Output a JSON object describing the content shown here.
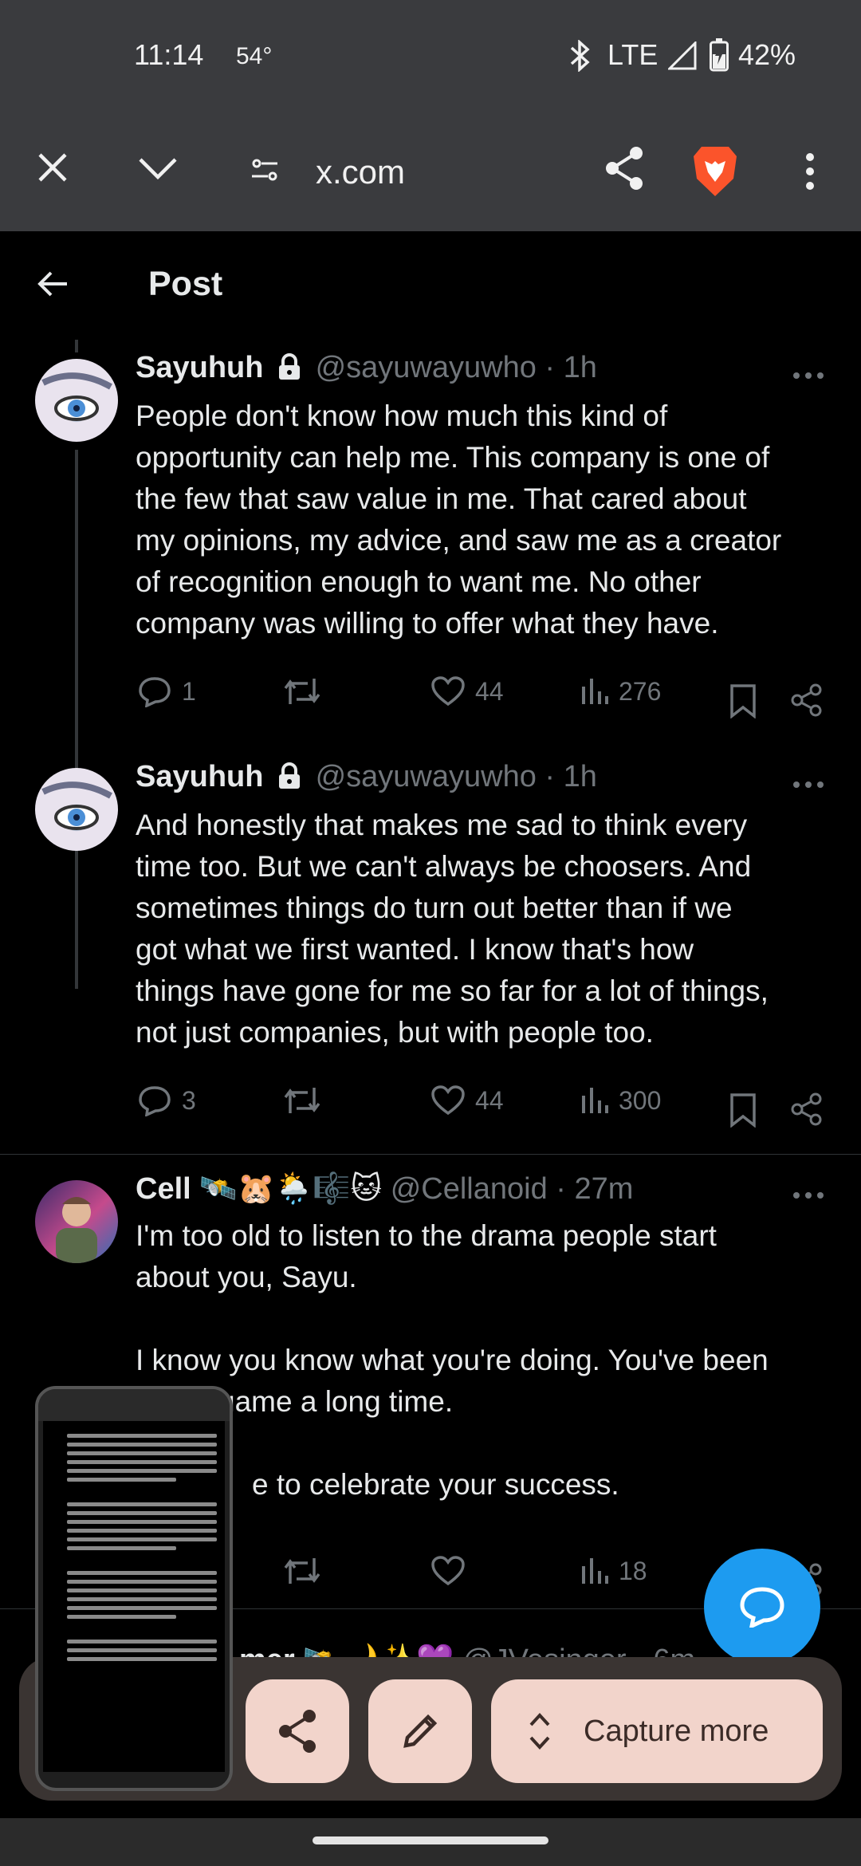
{
  "status_bar": {
    "time": "11:14",
    "temperature": "54°",
    "network": "LTE",
    "battery": "42%",
    "icons": [
      "bluetooth-icon",
      "signal-icon",
      "battery-charging-icon"
    ]
  },
  "browser": {
    "url": "x.com",
    "icons": [
      "close-icon",
      "chevron-down-icon",
      "site-settings-icon",
      "share-icon",
      "brave-lion-icon",
      "more-vert-icon"
    ]
  },
  "page_header": {
    "title": "Post"
  },
  "tweets": [
    {
      "name": "Sayuhuh",
      "handle": "@sayuwayuwho · 1h",
      "text": "People don't know how much this kind of\nopportunity can help me. This company is one of\nthe few that saw value in me. That cared about\nmy opinions, my advice, and saw me as a creator\nof recognition enough to want me. No other\ncompany was willing to offer what they have.",
      "replies": "1",
      "likes": "44",
      "views": "276"
    },
    {
      "name": "Sayuhuh",
      "handle": "@sayuwayuwho · 1h",
      "text": "And honestly that makes me sad to think every\ntime too. But we can't always be choosers. And\nsometimes things do turn out better than if we\ngot what we first wanted. I know that's how\nthings have gone for me so far for a lot of things,\nnot just companies, but with people too.",
      "replies": "3",
      "likes": "44",
      "views": "300"
    },
    {
      "name": "Cell",
      "emojis": "🛰️🐹🌦️🎼🐱",
      "handle": "@Cellanoid · 27m",
      "text_lines": [
        "I'm too old to listen to the drama people start",
        "about you, Sayu.",
        "",
        "I know you know what you're doing. You've been",
        "game a long time.",
        "",
        "e to celebrate your success."
      ],
      "views": "18"
    },
    {
      "name": "mer",
      "emojis": "🛰️🌙✨💜",
      "handle": "@JVesinger · 6m"
    }
  ],
  "capture": {
    "capture_more_label": "Capture more"
  },
  "colors": {
    "accent": "#1d9bf0",
    "capture_button": "#f2d4cb",
    "brave_orange": "#fb542b"
  }
}
